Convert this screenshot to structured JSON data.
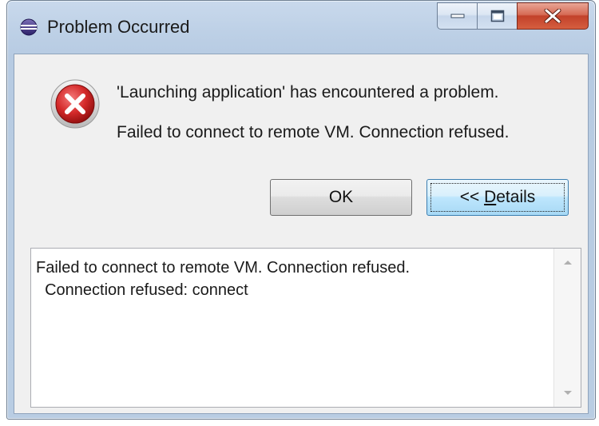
{
  "window": {
    "title": "Problem Occurred",
    "app_icon": "eclipse-icon",
    "caption_buttons": [
      "minimize-icon",
      "maximize-icon",
      "close-icon"
    ]
  },
  "message": {
    "icon": "error-icon",
    "line1": "'Launching application' has encountered a problem.",
    "line2": "Failed to connect to remote VM. Connection refused."
  },
  "buttons": {
    "ok_label": "OK",
    "details_prefix": "<< ",
    "details_mnemonic": "D",
    "details_rest": "etails"
  },
  "details": {
    "line1": "Failed to connect to remote VM. Connection refused.",
    "line2": "  Connection refused: connect"
  },
  "colors": {
    "accent": "#3c7fb1",
    "error_red": "#c8202a",
    "close_red": "#c2412a"
  }
}
